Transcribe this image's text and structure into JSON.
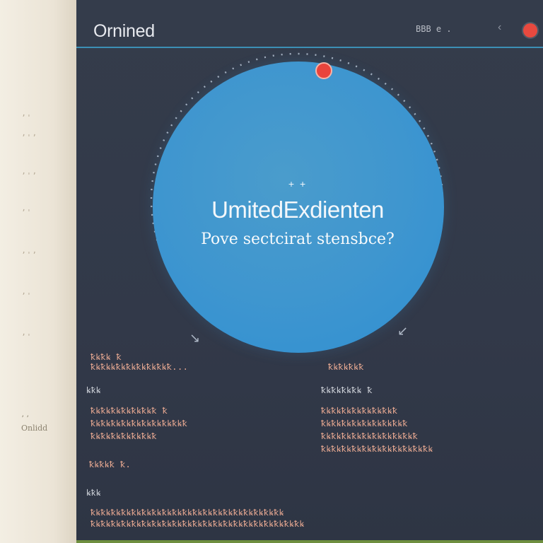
{
  "app": {
    "title": "Ornined",
    "header_text": "BBB e .",
    "back_symbol": "‹",
    "colors": {
      "accent": "#3c8fb5",
      "marker": "#e8493f",
      "circle": "#3f96cf"
    }
  },
  "left_panel": {
    "glyphs": [
      "ʼ'",
      "ʼ'ʼ",
      "ʼ'ʼ",
      "ʼ'",
      "ʼ'ʼ",
      "ʼ'",
      "ʼ'"
    ],
    "caption_line1": "ʼ ʼ",
    "caption_line2": "Onlidd"
  },
  "hero": {
    "tag": "+ +",
    "title": "UmitedExdienten",
    "subtitle": "Pove sectcirat stensbce?",
    "ticks": [
      "↘",
      "↙"
    ]
  },
  "rows": [
    {
      "text": "ꝁꝃꝁꝃ ꝁ",
      "head": false
    },
    {
      "text": "ꝁꝃꝁꝃꝃꝁꝃꝁꝃꝁꝃꝁꝃꝁꝃꝁ...",
      "head": false
    },
    {
      "text": "ꝁꝃꝁꝃꝁꝃꝁ",
      "head": false
    },
    {
      "text": "ꝃꝁꝃ",
      "head": true
    },
    {
      "text": "ꝁꝃꝁꝃꝁꝃꝁꝃ ꝁ",
      "head": true
    },
    {
      "text": "ꝁꝃꝁꝃꝁꝃꝁꝃꝁꝃꝁꝃꝁ ꝁ",
      "head": false
    },
    {
      "text": "ꝁꝃꝁꝃꝁꝃꝁꝃꝁꝃꝁꝃꝁꝃꝁꝃꝁꝃꝁ",
      "head": false
    },
    {
      "text": "ꝁꝃꝁꝃꝁꝃꝁꝃꝁꝃꝁꝃꝁ",
      "head": false
    },
    {
      "text": "ꝁꝃꝁꝃꝁꝃꝁꝃꝁꝃꝁꝃꝁꝃꝁ",
      "head": false
    },
    {
      "text": "ꝁꝃꝁꝃꝁꝃꝁꝃꝁꝃꝁꝃꝁꝃꝁꝃꝁ",
      "head": false
    },
    {
      "text": "ꝁꝃꝁꝃꝁꝃꝁꝃꝁꝃꝁꝃꝁꝃꝁꝃꝁꝃꝁ",
      "head": false
    },
    {
      "text": "ꝁꝃꝁꝃꝁꝃꝁꝃꝁꝃꝁꝃꝁꝃꝁꝃꝁꝃꝁꝃꝁꝃ",
      "head": false
    },
    {
      "text": "ꝁꝃꝁꝃꝁ ꝁ.",
      "head": false
    },
    {
      "text": "ꝃꝁꝃ",
      "head": true
    },
    {
      "text": "ꝁꝃꝁꝃꝁꝃꝁꝃꝁꝃꝁꝃꝁꝃꝁꝃꝁꝃꝁꝃꝁꝃꝁꝃꝁꝃꝁꝃꝁꝃꝁꝃꝁꝃꝁꝃꝁꝃ",
      "head": false
    },
    {
      "text": "ꝁꝃꝁꝃꝁꝃꝁꝃꝁꝃꝁꝃꝁꝃꝁꝃꝁꝃꝁꝃꝁꝃꝁꝃꝁꝃꝁꝃꝁꝃꝁꝃꝁꝃꝁꝃꝁꝃꝁꝃꝁꝃ",
      "head": false
    }
  ]
}
